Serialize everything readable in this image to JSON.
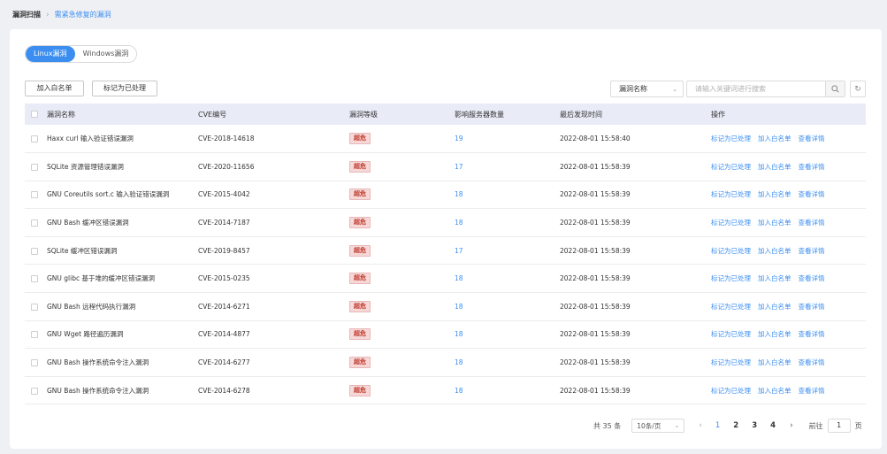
{
  "breadcrumb": {
    "root": "漏洞扫描",
    "current": "需紧急修复的漏洞"
  },
  "tabs": [
    {
      "label": "Linux漏洞",
      "active": true
    },
    {
      "label": "Windows漏洞",
      "active": false
    }
  ],
  "toolbar": {
    "whitelist_label": "加入白名单",
    "mark_label": "标记为已处理"
  },
  "filter": {
    "field_label": "漏洞名称",
    "search_placeholder": "请输入关键词进行搜索"
  },
  "table": {
    "headers": [
      "漏洞名称",
      "CVE编号",
      "漏洞等级",
      "影响服务器数量",
      "最后发现时间",
      "操作"
    ],
    "actions": [
      "标记为已处理",
      "加入白名单",
      "查看详情"
    ],
    "rows": [
      {
        "name": "Haxx curl 输入验证错误漏洞",
        "cve": "CVE-2018-14618",
        "level": "超危",
        "count": "19",
        "time": "2022-08-01 15:58:40"
      },
      {
        "name": "SQLite 资源管理错误漏洞",
        "cve": "CVE-2020-11656",
        "level": "超危",
        "count": "17",
        "time": "2022-08-01 15:58:39"
      },
      {
        "name": "GNU Coreutils sort.c 输入验证错误漏洞",
        "cve": "CVE-2015-4042",
        "level": "超危",
        "count": "18",
        "time": "2022-08-01 15:58:39"
      },
      {
        "name": "GNU Bash 缓冲区错误漏洞",
        "cve": "CVE-2014-7187",
        "level": "超危",
        "count": "18",
        "time": "2022-08-01 15:58:39"
      },
      {
        "name": "SQLite 缓冲区错误漏洞",
        "cve": "CVE-2019-8457",
        "level": "超危",
        "count": "17",
        "time": "2022-08-01 15:58:39"
      },
      {
        "name": "GNU glibc 基于堆的缓冲区错误漏洞",
        "cve": "CVE-2015-0235",
        "level": "超危",
        "count": "18",
        "time": "2022-08-01 15:58:39"
      },
      {
        "name": "GNU Bash 远程代码执行漏洞",
        "cve": "CVE-2014-6271",
        "level": "超危",
        "count": "18",
        "time": "2022-08-01 15:58:39"
      },
      {
        "name": "GNU Wget 路径遍历漏洞",
        "cve": "CVE-2014-4877",
        "level": "超危",
        "count": "18",
        "time": "2022-08-01 15:58:39"
      },
      {
        "name": "GNU Bash 操作系统命令注入漏洞",
        "cve": "CVE-2014-6277",
        "level": "超危",
        "count": "18",
        "time": "2022-08-01 15:58:39"
      },
      {
        "name": "GNU Bash 操作系统命令注入漏洞",
        "cve": "CVE-2014-6278",
        "level": "超危",
        "count": "18",
        "time": "2022-08-01 15:58:39"
      }
    ]
  },
  "pagination": {
    "total": "共 35 条",
    "page_size": "10条/页",
    "pages": [
      "1",
      "2",
      "3",
      "4"
    ],
    "current": "1",
    "goto_label": "前往",
    "goto_value": "1",
    "goto_suffix": "页"
  },
  "colors": {
    "primary": "#3b8ef0",
    "danger_text": "#c0392b",
    "danger_bg": "#f6d8d8",
    "header_bg": "#e9ecf7"
  }
}
